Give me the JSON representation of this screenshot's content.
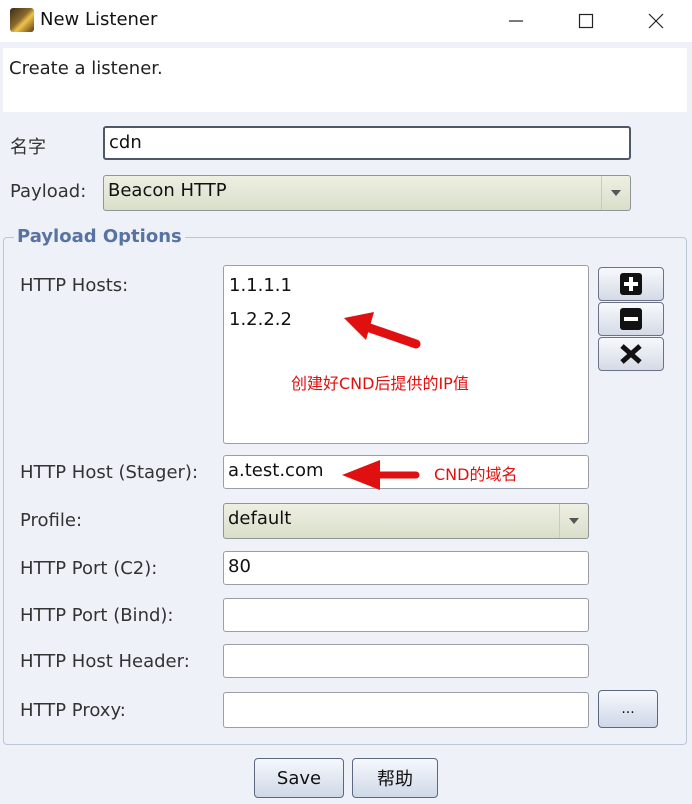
{
  "window": {
    "title": "New Listener",
    "description": "Create a listener.",
    "controls": [
      "minimize-icon",
      "maximize-icon",
      "close-icon"
    ]
  },
  "form": {
    "name_label": "名字",
    "name_value": "cdn",
    "payload_label": "Payload:",
    "payload_value": "Beacon HTTP"
  },
  "payload_options": {
    "title": "Payload Options",
    "http_hosts_label": "HTTP Hosts:",
    "http_hosts": [
      "1.1.1.1",
      "1.2.2.2"
    ],
    "stager_label": "HTTP Host (Stager):",
    "stager_value": "a.test.com",
    "profile_label": "Profile:",
    "profile_value": "default",
    "port_c2_label": "HTTP Port (C2):",
    "port_c2_value": "80",
    "port_bind_label": "HTTP Port (Bind):",
    "port_bind_value": "",
    "host_header_label": "HTTP Host Header:",
    "host_header_value": "",
    "proxy_label": "HTTP Proxy:",
    "proxy_value": "",
    "proxy_button_label": "...",
    "host_buttons": [
      "add-icon",
      "remove-icon",
      "clear-icon"
    ]
  },
  "annotations": {
    "hosts_note": "创建好CND后提供的IP值",
    "stager_note": "CND的域名",
    "color": "#e01010"
  },
  "footer": {
    "save_label": "Save",
    "help_label": "帮助"
  }
}
